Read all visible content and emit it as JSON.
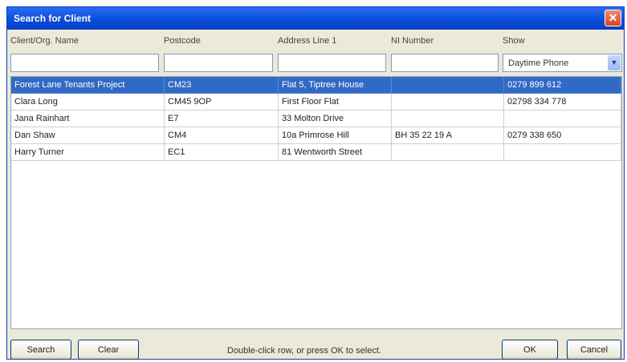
{
  "window": {
    "title": "Search for Client",
    "close_icon": "close-icon"
  },
  "filters": {
    "headers": [
      "Client/Org. Name",
      "Postcode",
      "Address Line 1",
      "NI Number",
      "Show"
    ],
    "values": [
      "",
      "",
      "",
      ""
    ],
    "show_selected": "Daytime Phone"
  },
  "table": {
    "selected_row": 0,
    "rows": [
      [
        "Forest Lane Tenants Project",
        "CM23",
        "Flat 5, Tiptree House",
        "",
        "0279 899 612"
      ],
      [
        "Clara Long",
        "CM45 9OP",
        "First Floor Flat",
        "",
        "02798 334 778"
      ],
      [
        "Jana Rainhart",
        "E7",
        "33 Molton Drive",
        "",
        ""
      ],
      [
        "Dan Shaw",
        "CM4",
        "10a Primrose Hill",
        "BH 35 22 19 A",
        "0279 338 650"
      ],
      [
        "Harry Turner",
        "EC1",
        "81 Wentworth Street",
        "",
        ""
      ]
    ]
  },
  "footer": {
    "search_label": "Search",
    "clear_label": "Clear",
    "hint": "Double-click row, or press OK to select.",
    "ok_label": "OK",
    "cancel_label": "Cancel"
  },
  "colors": {
    "titlebar": "#0a4ad8",
    "selection": "#316ac5",
    "dialog_bg": "#ece9d8"
  }
}
